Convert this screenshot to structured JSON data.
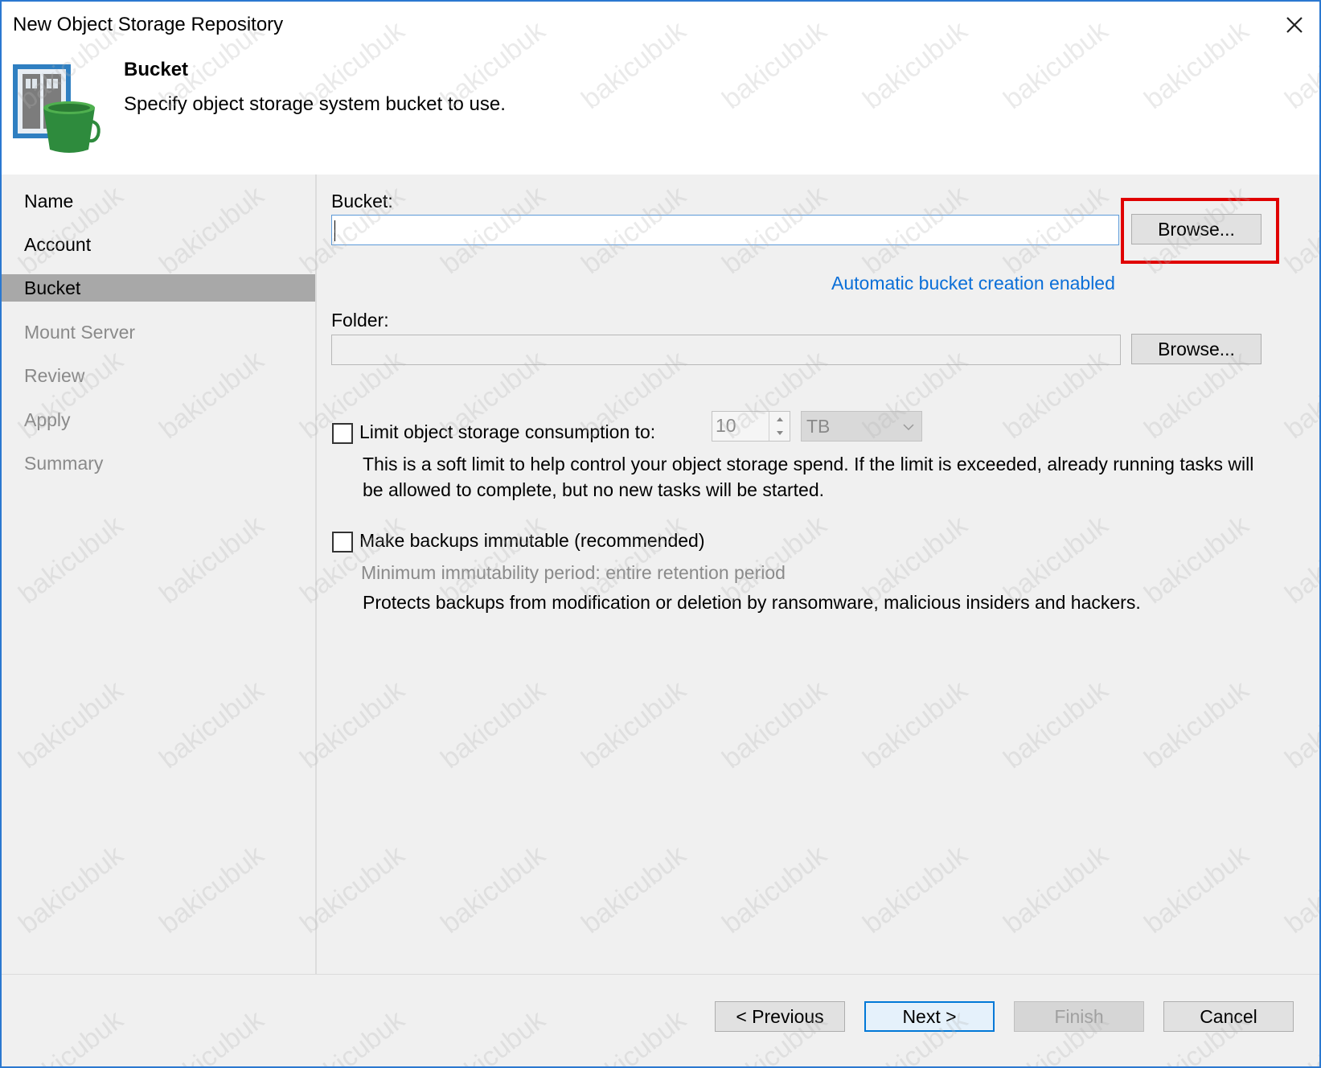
{
  "window": {
    "title": "New Object Storage Repository"
  },
  "header": {
    "step_title": "Bucket",
    "step_description": "Specify object storage system bucket to use."
  },
  "nav": {
    "items": [
      {
        "label": "Name"
      },
      {
        "label": "Account"
      },
      {
        "label": "Bucket"
      },
      {
        "label": "Mount Server"
      },
      {
        "label": "Review"
      },
      {
        "label": "Apply"
      },
      {
        "label": "Summary"
      }
    ]
  },
  "form": {
    "bucket_label": "Bucket:",
    "bucket_value": "",
    "bucket_browse": "Browse...",
    "auto_bucket_link": "Automatic bucket creation enabled",
    "folder_label": "Folder:",
    "folder_value": "",
    "folder_browse": "Browse...",
    "limit_checkbox_label": "Limit object storage consumption to:",
    "limit_value": "10",
    "limit_unit": "TB",
    "limit_desc_line1": "This is a soft limit to help control your object storage spend. If the limit is exceeded, already running tasks will",
    "limit_desc_line2": "be allowed to complete, but no new tasks will be started.",
    "immutable_checkbox_label": "Make backups immutable (recommended)",
    "immutable_period": "Minimum immutability period: entire retention period",
    "immutable_desc": "Protects backups from modification or deletion by ransomware, malicious insiders and hackers."
  },
  "footer": {
    "previous": "< Previous",
    "next": "Next >",
    "finish": "Finish",
    "cancel": "Cancel"
  },
  "watermark": "bakicubuk"
}
